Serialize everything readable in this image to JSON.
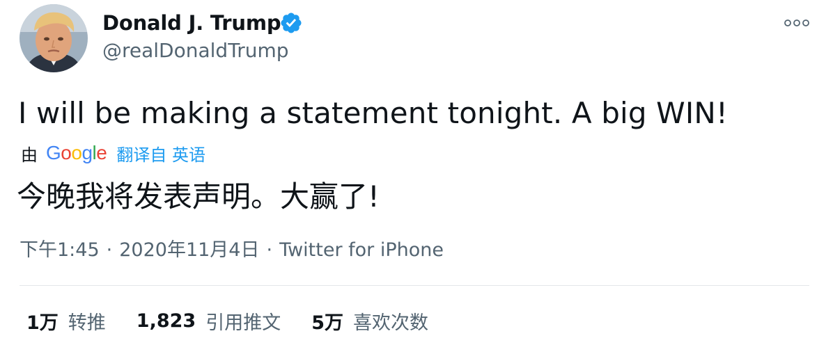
{
  "user": {
    "display_name": "Donald J. Trump",
    "handle": "@realDonaldTrump",
    "verified": true
  },
  "tweet": {
    "text": "I will be making a statement tonight. A big WIN!",
    "translate": {
      "by_label": "由",
      "provider": "Google",
      "link_text": "翻译自 英语"
    },
    "translated_text": "今晚我将发表声明。大赢了!"
  },
  "meta": {
    "time": "下午1:45",
    "separator": "·",
    "date": "2020年11月4日",
    "source": "Twitter for iPhone"
  },
  "stats": [
    {
      "count": "1万",
      "label": "转推"
    },
    {
      "count": "1,823",
      "label": "引用推文"
    },
    {
      "count": "5万",
      "label": "喜欢次数"
    }
  ],
  "icons": {
    "verified": "verified-badge-icon",
    "more": "more-options-icon"
  },
  "colors": {
    "accent": "#1d9bf0",
    "text_primary": "#0f1419",
    "text_secondary": "#536471",
    "divider": "#e3e7ea"
  }
}
